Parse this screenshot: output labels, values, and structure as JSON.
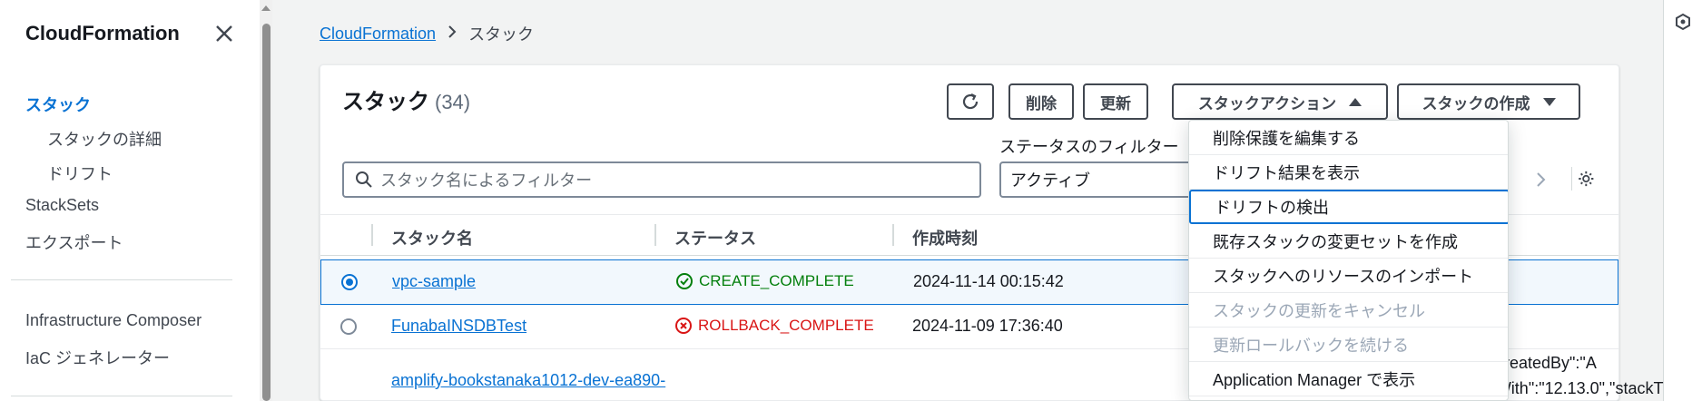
{
  "sidebar": {
    "title": "CloudFormation",
    "items": [
      {
        "label": "スタック",
        "active": true
      },
      {
        "label": "スタックの詳細"
      },
      {
        "label": "ドリフト"
      },
      {
        "label": "StackSets"
      },
      {
        "label": "エクスポート"
      },
      {
        "label": "Infrastructure Composer"
      },
      {
        "label": "IaC ジェネレーター"
      }
    ]
  },
  "breadcrumb": {
    "root": "CloudFormation",
    "current": "スタック"
  },
  "panel": {
    "title": "スタック",
    "count": "(34)",
    "buttons": {
      "refresh_icon": "refresh-icon",
      "delete": "削除",
      "update": "更新",
      "stack_actions": "スタックアクション",
      "create_stack": "スタックの作成"
    },
    "filter_label": "ステータスのフィルター",
    "search_placeholder": "スタック名によるフィルター",
    "status_filter_value": "アクティブ"
  },
  "table": {
    "columns": [
      "スタック名",
      "ステータス",
      "作成時刻"
    ],
    "rows": [
      {
        "name": "vpc-sample",
        "status": "CREATE_COMPLETE",
        "status_kind": "success",
        "created": "2024-11-14 00:15:42",
        "selected": true
      },
      {
        "name": "FunabaINSDBTest",
        "status": "ROLLBACK_COMPLETE",
        "status_kind": "error",
        "created": "2024-11-09 17:36:40",
        "selected": false
      },
      {
        "name": "amplify-bookstanaka1012-dev-ea890-",
        "status": "",
        "created": "",
        "selected": false,
        "desc_line1": "reatedBy\":\"A",
        "desc_line2": "mplify\",\"createdWith\":\"12.13.0\",\"stackT"
      }
    ]
  },
  "menu": {
    "items": [
      {
        "label": "削除保護を編集する",
        "disabled": false
      },
      {
        "label": "ドリフト結果を表示",
        "disabled": false
      },
      {
        "label": "ドリフトの検出",
        "disabled": false,
        "focused": true
      },
      {
        "label": "既存スタックの変更セットを作成",
        "disabled": false
      },
      {
        "label": "スタックへのリソースのインポート",
        "disabled": false
      },
      {
        "label": "スタックの更新をキャンセル",
        "disabled": true
      },
      {
        "label": "更新ロールバックを続ける",
        "disabled": true
      },
      {
        "label": "Application Manager で表示",
        "disabled": false
      }
    ]
  },
  "colors": {
    "link": "#0972d3",
    "success": "#037f0c",
    "error": "#d91515",
    "disabled": "#9ba7b6"
  }
}
